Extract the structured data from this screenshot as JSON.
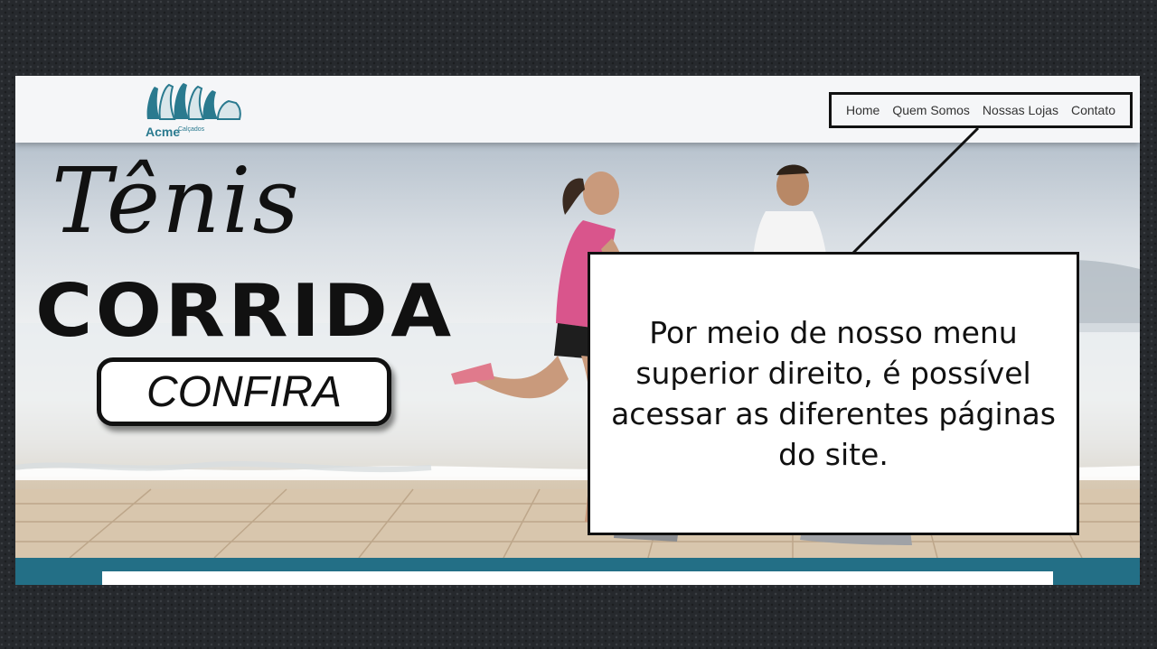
{
  "logo": {
    "brand": "Acme",
    "sub": "Calçados"
  },
  "nav": {
    "items": [
      {
        "label": "Home"
      },
      {
        "label": "Quem Somos"
      },
      {
        "label": "Nossas Lojas"
      },
      {
        "label": "Contato"
      }
    ]
  },
  "hero": {
    "script_title": "Tênis",
    "title": "CORRIDA",
    "cta_label": "CONFIRA"
  },
  "callout": {
    "text": "Por meio de nosso menu superior direito, é possível acessar as diferentes páginas do site."
  },
  "colors": {
    "background": "#26292d",
    "header": "#f5f6f8",
    "brand_teal": "#236f86",
    "text": "#111111"
  }
}
